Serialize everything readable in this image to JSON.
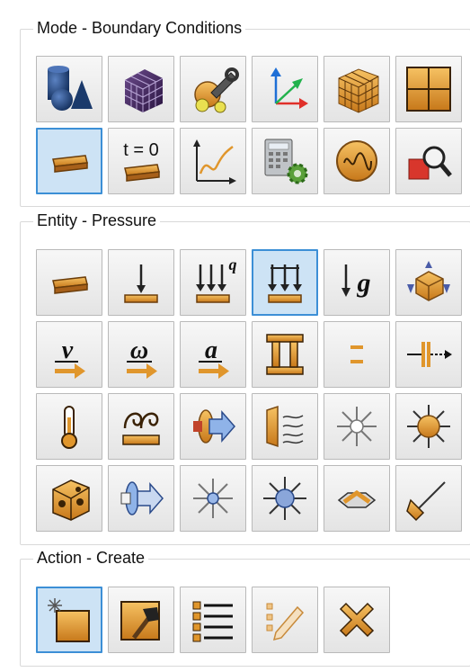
{
  "panels": {
    "mode": {
      "title": "Mode - Boundary Conditions",
      "rows": [
        [
          {
            "name": "geometry-icon",
            "label": "Geometry"
          },
          {
            "name": "mesh-icon",
            "label": "Mesh"
          },
          {
            "name": "properties-icon",
            "label": "Properties"
          },
          {
            "name": "coordinate-system-icon",
            "label": "Coordinate System"
          },
          {
            "name": "element-block-icon",
            "label": "Element Blocks"
          },
          {
            "name": "nodeset-icon",
            "label": "Nodesets"
          }
        ],
        [
          {
            "name": "boundary-conditions-icon",
            "label": "Boundary Conditions",
            "active": true
          },
          {
            "name": "initial-conditions-icon",
            "label": "Initial Conditions",
            "text": "t = 0"
          },
          {
            "name": "time-curve-icon",
            "label": "Time Curves"
          },
          {
            "name": "analysis-settings-icon",
            "label": "Analysis Settings"
          },
          {
            "name": "wave-icon",
            "label": "Waves"
          },
          {
            "name": "inspect-icon",
            "label": "Inspect"
          }
        ]
      ]
    },
    "entity": {
      "title": "Entity - Pressure",
      "rows": [
        [
          {
            "name": "surface-icon",
            "label": "Surface"
          },
          {
            "name": "force-icon",
            "label": "Force"
          },
          {
            "name": "heat-flux-icon",
            "label": "Heat Flux",
            "text": "q"
          },
          {
            "name": "pressure-icon",
            "label": "Pressure",
            "active": true
          },
          {
            "name": "gravity-icon",
            "label": "Gravity",
            "text": "g"
          },
          {
            "name": "constraint-icon",
            "label": "Constraint"
          }
        ],
        [
          {
            "name": "velocity-icon",
            "label": "Velocity",
            "text": "v"
          },
          {
            "name": "angular-velocity-icon",
            "label": "Angular Velocity",
            "text": "ω"
          },
          {
            "name": "acceleration-icon",
            "label": "Acceleration",
            "text": "a"
          },
          {
            "name": "displacement-icon",
            "label": "Displacement"
          },
          {
            "name": "contact-icon",
            "label": "Contact"
          },
          {
            "name": "axial-icon",
            "label": "Axial"
          }
        ],
        [
          {
            "name": "temperature-icon",
            "label": "Temperature"
          },
          {
            "name": "convection-icon",
            "label": "Convection"
          },
          {
            "name": "flow-icon",
            "label": "Flow"
          },
          {
            "name": "radiation-wall-icon",
            "label": "Radiation"
          },
          {
            "name": "point-source-icon",
            "label": "Point Source"
          },
          {
            "name": "heat-source-icon",
            "label": "Heat Source"
          }
        ],
        [
          {
            "name": "volume-source-icon",
            "label": "Volume Source"
          },
          {
            "name": "rotation-icon",
            "label": "Rotation"
          },
          {
            "name": "light-point-icon",
            "label": "Light Point"
          },
          {
            "name": "dark-point-icon",
            "label": "Dark Point"
          },
          {
            "name": "spring-icon",
            "label": "Spring"
          },
          {
            "name": "rigid-link-icon",
            "label": "Rigid Link"
          }
        ]
      ]
    },
    "action": {
      "title": "Action - Create",
      "rows": [
        [
          {
            "name": "create-icon",
            "label": "Create",
            "active": true
          },
          {
            "name": "modify-icon",
            "label": "Modify"
          },
          {
            "name": "list-icon",
            "label": "List"
          },
          {
            "name": "edit-icon",
            "label": "Edit"
          },
          {
            "name": "delete-icon",
            "label": "Delete"
          }
        ]
      ]
    }
  },
  "colors": {
    "orange": "#e0962c",
    "active_border": "#3c8fd6",
    "active_bg": "#cde3f5",
    "navy": "#1b3a6b",
    "purple": "#3b1f56"
  }
}
